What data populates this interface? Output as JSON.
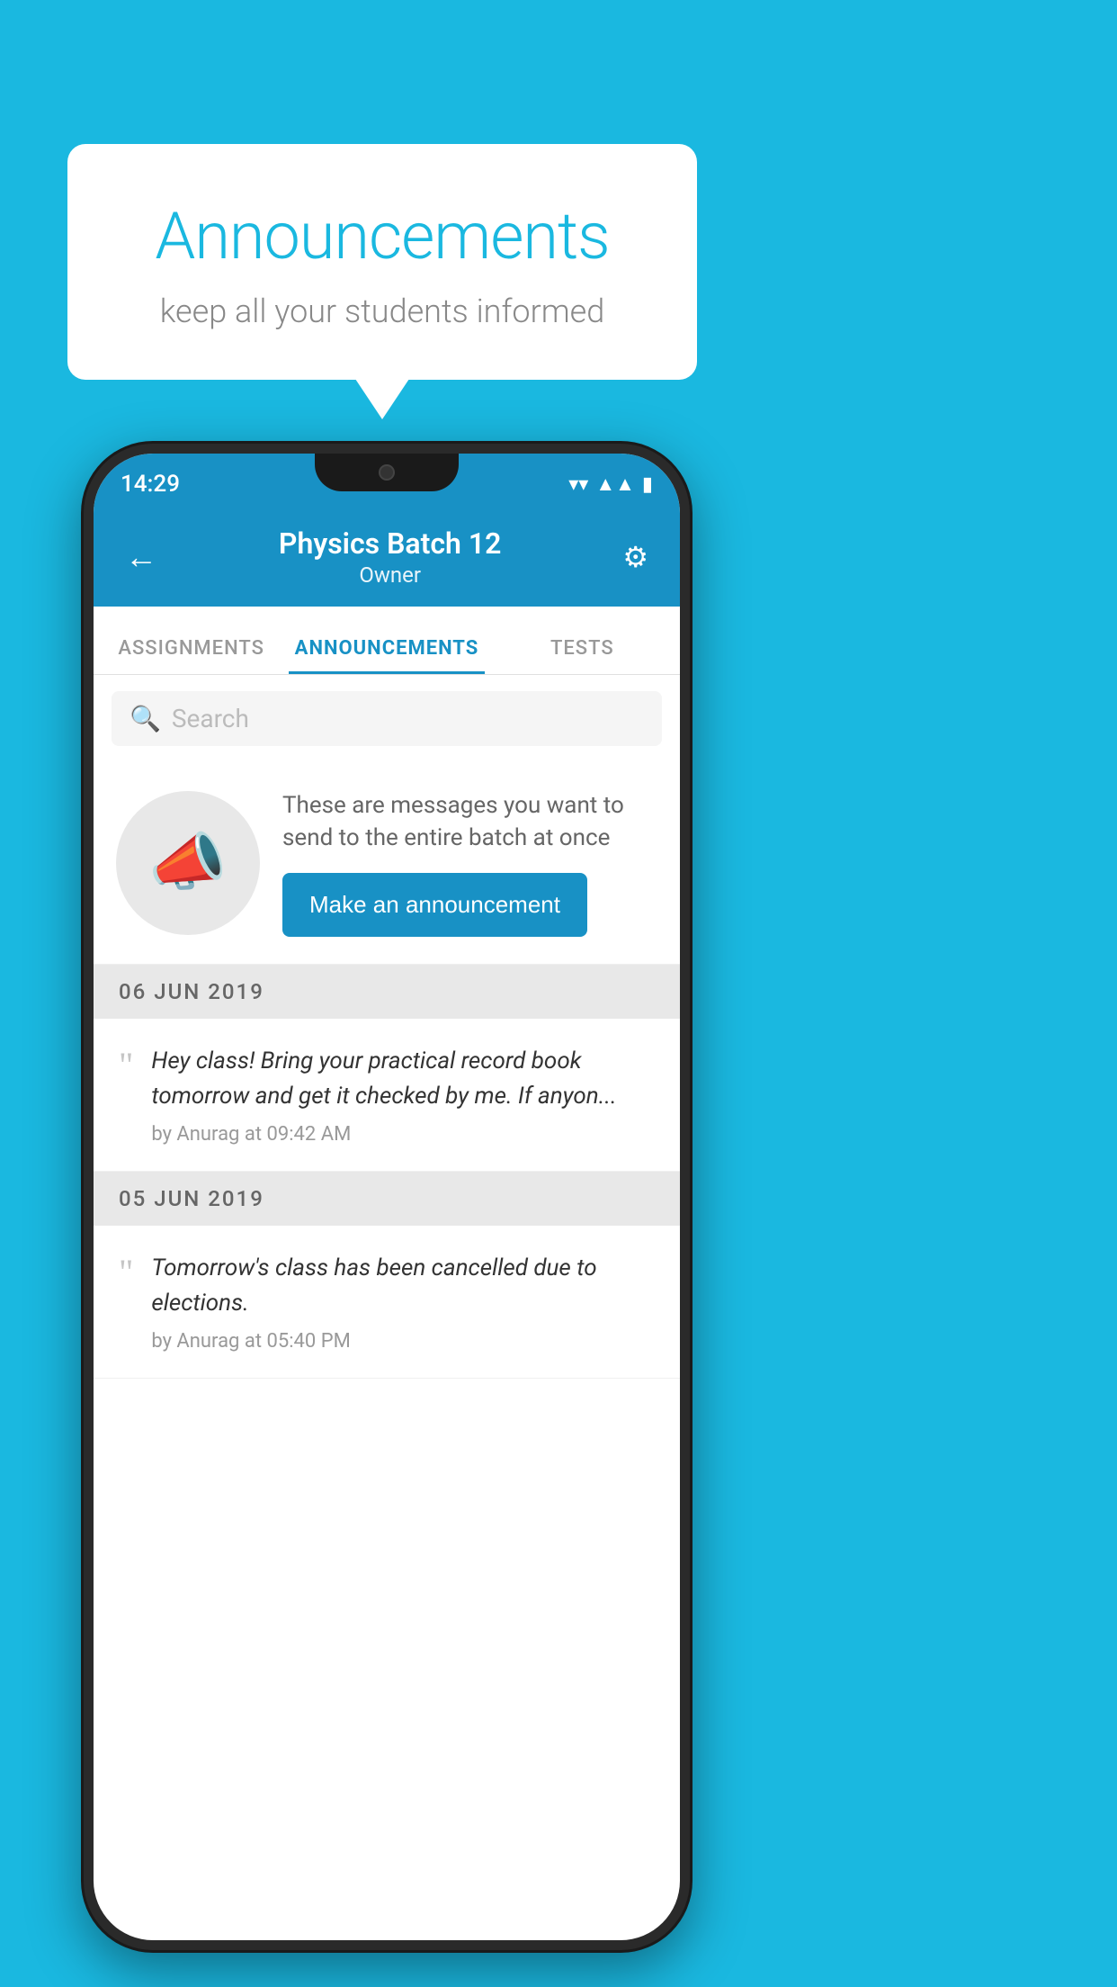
{
  "background_color": "#1ab8e0",
  "speech_bubble": {
    "title": "Announcements",
    "subtitle": "keep all your students informed"
  },
  "phone": {
    "status_bar": {
      "time": "14:29"
    },
    "app_bar": {
      "title": "Physics Batch 12",
      "subtitle": "Owner",
      "back_label": "←",
      "settings_label": "⚙"
    },
    "tabs": [
      {
        "label": "ASSIGNMENTS",
        "active": false
      },
      {
        "label": "ANNOUNCEMENTS",
        "active": true
      },
      {
        "label": "TESTS",
        "active": false
      },
      {
        "label": "...",
        "active": false
      }
    ],
    "search": {
      "placeholder": "Search"
    },
    "promo": {
      "text": "These are messages you want to send to the entire batch at once",
      "button_label": "Make an announcement"
    },
    "announcements": [
      {
        "date": "06  JUN  2019",
        "text": "Hey class! Bring your practical record book tomorrow and get it checked by me. If anyon...",
        "meta": "by Anurag at 09:42 AM"
      },
      {
        "date": "05  JUN  2019",
        "text": "Tomorrow's class has been cancelled due to elections.",
        "meta": "by Anurag at 05:40 PM"
      }
    ]
  }
}
